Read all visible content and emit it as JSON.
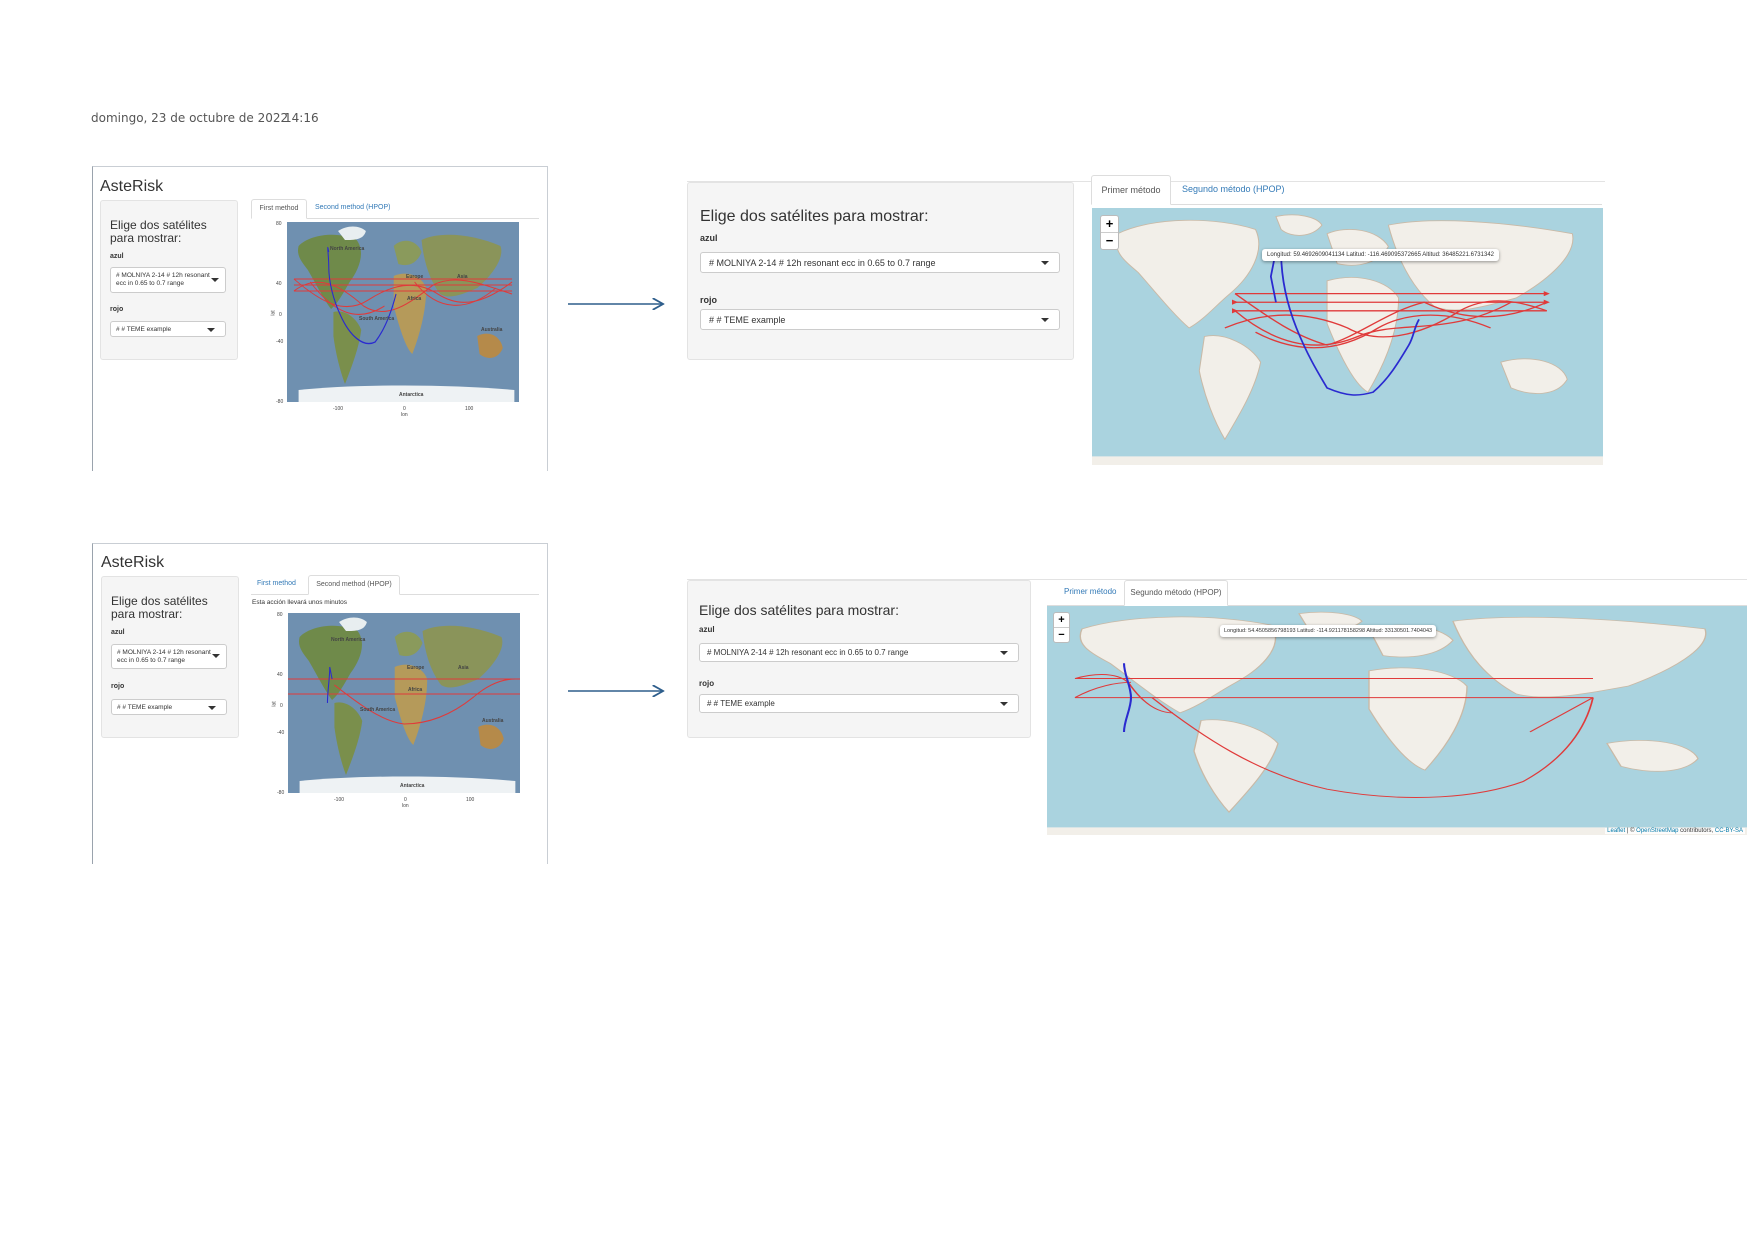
{
  "header": {
    "date": "domingo, 23 de octubre de 2022",
    "time": "14:16"
  },
  "colors": {
    "azul": "#3333dd",
    "rojo": "#e03a3a",
    "link": "#337ab7",
    "ocean": "#aad3df",
    "land": "#f2efe9"
  },
  "shot1": {
    "app_title": "AsteRisk",
    "panel_title": "Elige dos satélites para mostrar:",
    "azul_label": "azul",
    "azul_value": "# MOLNIYA 2-14 # 12h resonant ecc in 0.65 to 0.7 range",
    "rojo_label": "rojo",
    "rojo_value": "# # TEME example",
    "tabs": [
      "First method",
      "Second method (HPOP)"
    ],
    "active_tab": 0,
    "map_labels": {
      "north_america": "North America",
      "south_america": "South America",
      "europe": "Europe",
      "africa": "Africa",
      "asia": "Asia",
      "australia": "Australia",
      "antarctica": "Antarctica"
    },
    "axis": {
      "y_ticks": [
        "80",
        "40",
        "0",
        "-40",
        "-80"
      ],
      "x_ticks": [
        "-100",
        "0",
        "100"
      ],
      "xlabel": "lon",
      "ylabel": "lat"
    }
  },
  "shot2": {
    "panel_title": "Elige dos satélites para mostrar:",
    "azul_label": "azul",
    "azul_value": "# MOLNIYA 2-14 # 12h resonant ecc in 0.65 to 0.7 range",
    "rojo_label": "rojo",
    "rojo_value": "# # TEME example",
    "tabs": [
      "Primer método",
      "Segundo método (HPOP)"
    ],
    "active_tab": 0,
    "tooltip": "Longitud: 59.4692609041134 Latitud: -116.469095372665 Altitud: 36485221.6731342",
    "zoom_in": "+",
    "zoom_out": "−"
  },
  "shot3": {
    "app_title": "AsteRisk",
    "panel_title": "Elige dos satélites para mostrar:",
    "azul_label": "azul",
    "azul_value": "# MOLNIYA 2-14 # 12h resonant ecc in 0.65 to 0.7 range",
    "rojo_label": "rojo",
    "rojo_value": "# # TEME example",
    "tabs": [
      "First method",
      "Second method (HPOP)"
    ],
    "active_tab": 1,
    "note": "Esta acción llevará unos minutos",
    "map_labels": {
      "north_america": "North America",
      "south_america": "South America",
      "europe": "Europe",
      "africa": "Africa",
      "asia": "Asia",
      "australia": "Australia",
      "antarctica": "Antarctica"
    },
    "axis": {
      "y_ticks": [
        "80",
        "40",
        "0",
        "-40",
        "-80"
      ],
      "x_ticks": [
        "-100",
        "0",
        "100"
      ],
      "xlabel": "lon",
      "ylabel": "lat"
    }
  },
  "shot4": {
    "panel_title": "Elige dos satélites para mostrar:",
    "azul_label": "azul",
    "azul_value": "# MOLNIYA 2-14 # 12h resonant ecc in 0.65 to 0.7 range",
    "rojo_label": "rojo",
    "rojo_value": "# # TEME example",
    "tabs": [
      "Primer método",
      "Segundo método (HPOP)"
    ],
    "active_tab": 1,
    "tooltip": "Longitud: 54.4505856798193 Latitud: -114.921178158298 Altitud: 33130501.7404043",
    "zoom_in": "+",
    "zoom_out": "−",
    "attribution": {
      "leaflet": "Leaflet",
      "sep": " | © ",
      "osm": "OpenStreetMap",
      "contrib": " contributors, ",
      "license": "CC-BY-SA"
    }
  }
}
